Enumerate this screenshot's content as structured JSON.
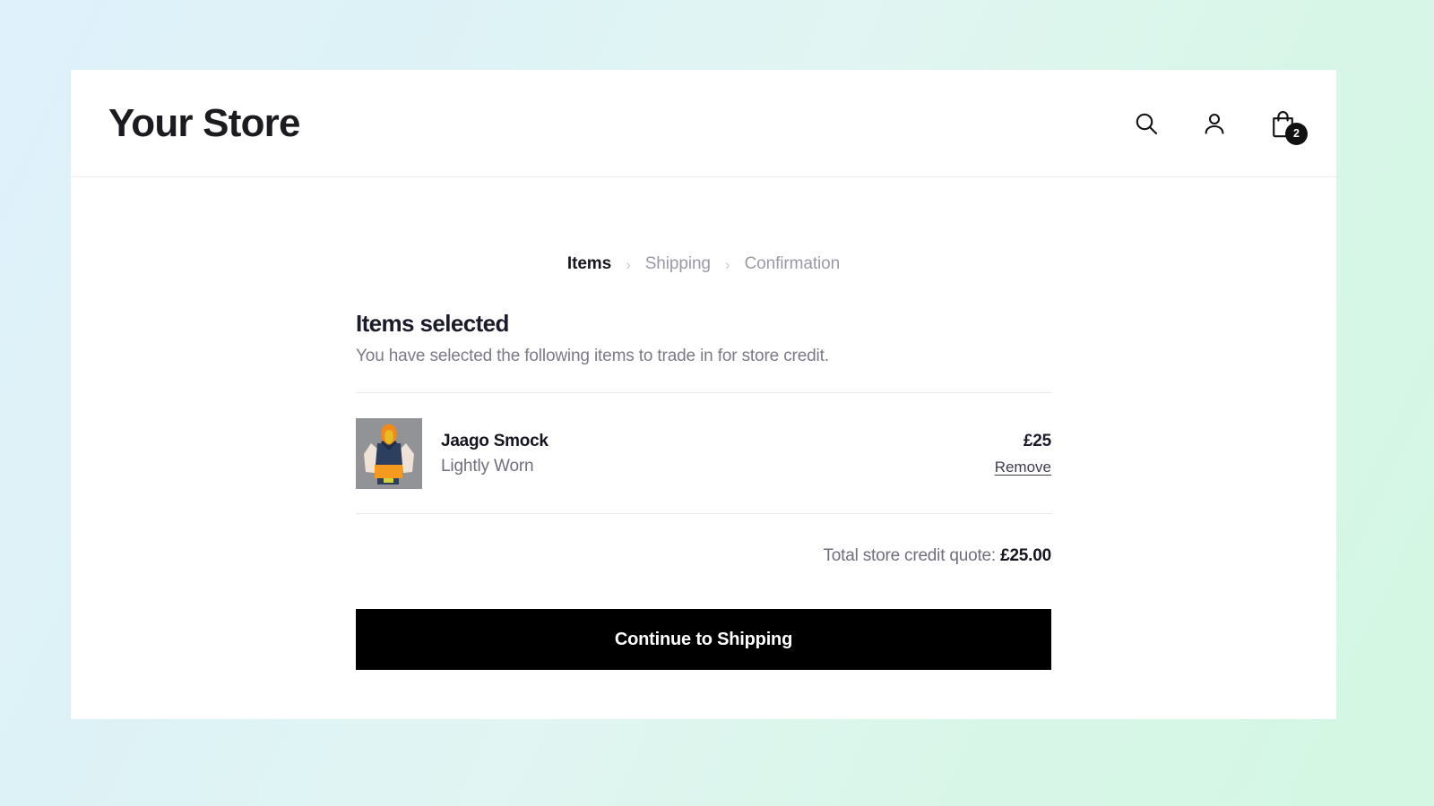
{
  "theme": {
    "background_gradient_from": "#dff1fb",
    "background_gradient_to": "#d3f7e3",
    "card_background": "#ffffff",
    "accent_button": "#000000",
    "muted_text": "#7b7b87",
    "heading_text": "#1b1b2b"
  },
  "header": {
    "brand": "Your Store",
    "icons": {
      "search": "search-icon",
      "account": "user-icon",
      "cart": "shopping-bag-icon"
    },
    "cart_count": "2"
  },
  "steps": [
    {
      "label": "Items",
      "state": "active"
    },
    {
      "label": "Shipping",
      "state": "upcoming"
    },
    {
      "label": "Confirmation",
      "state": "upcoming"
    }
  ],
  "step_separator": "›",
  "panel": {
    "title": "Items selected",
    "subtitle": "You have selected the following items to trade in for store credit."
  },
  "items": [
    {
      "name": "Jaago Smock",
      "condition": "Lightly Worn",
      "price": "£25",
      "remove_label": "Remove",
      "thumbnail": {
        "alt": "Jaago Smock product photo",
        "background": "#8e9095",
        "hood": "#f08a18",
        "body": "#2c3f5e",
        "sleeves": "#efe2d6",
        "pocket": "#f39a1f",
        "hem": "#d4d03a"
      }
    }
  ],
  "total": {
    "label": "Total store credit quote:",
    "amount": "£25.00"
  },
  "cta": {
    "label": "Continue to Shipping"
  }
}
